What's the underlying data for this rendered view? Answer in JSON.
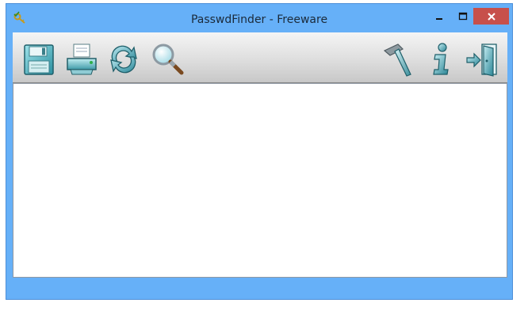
{
  "window": {
    "title": "PasswdFinder - Freeware"
  },
  "titlebar": {
    "icons": [
      "key-check-icon",
      "minimize-icon",
      "maximize-icon",
      "close-icon"
    ]
  },
  "toolbar": {
    "left_icons": [
      "floppy-disk-icon",
      "printer-icon",
      "refresh-icon",
      "magnifier-icon"
    ],
    "right_icons": [
      "hammer-icon",
      "info-icon",
      "exit-door-icon"
    ]
  },
  "colors": {
    "window_frame": "#66b0f8",
    "close_button": "#c7504b",
    "content_bg": "#ffffff"
  }
}
